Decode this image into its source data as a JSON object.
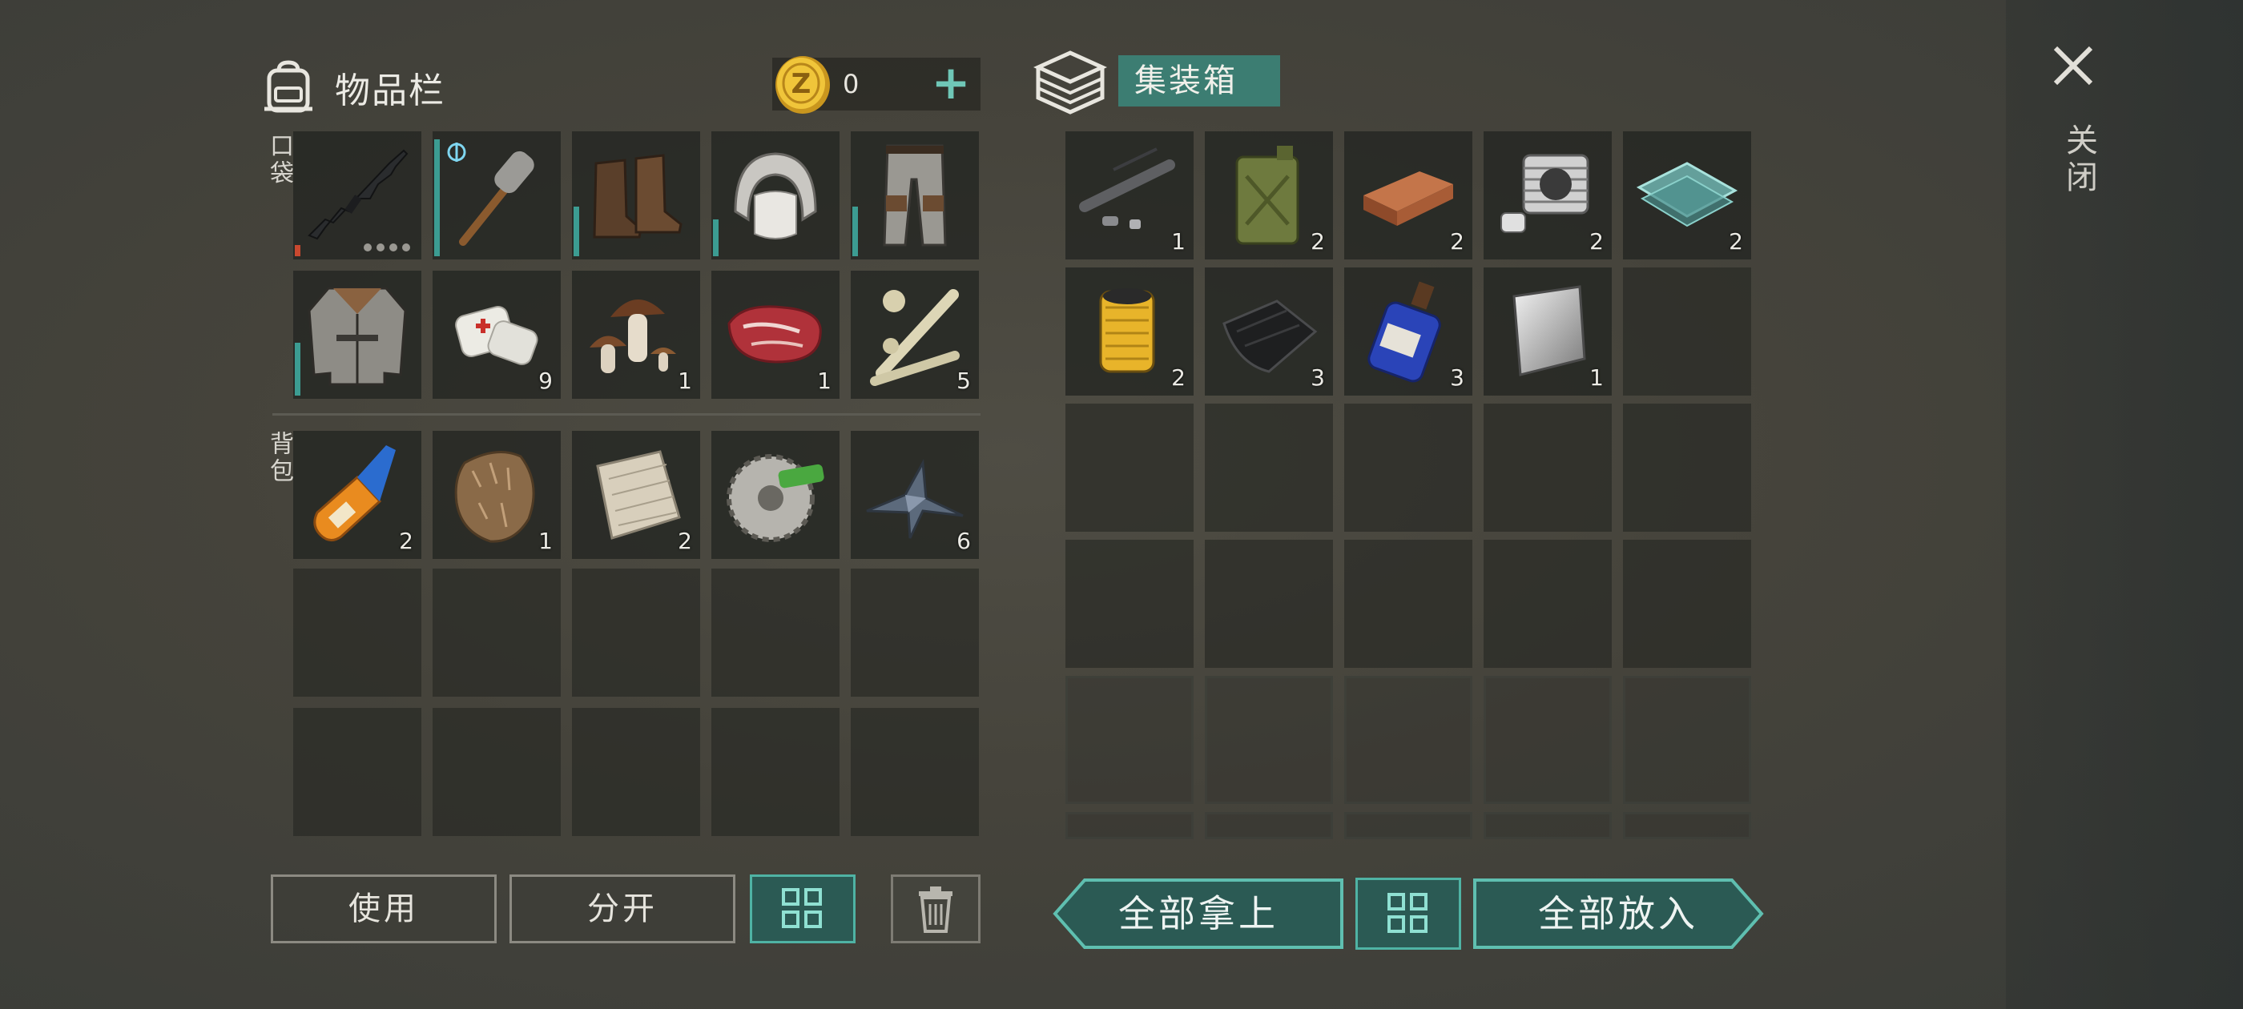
{
  "inventory": {
    "title": "物品栏",
    "coins": {
      "count": "0",
      "add_label": "+"
    },
    "section_pockets": "口袋",
    "section_backpack": "背包",
    "pockets": [
      {
        "name": "assault-rifle",
        "qty": "",
        "dots": 4,
        "durability": "low"
      },
      {
        "name": "spiked-club",
        "qty": "",
        "durability": 0.95
      },
      {
        "name": "leather-boots",
        "qty": "",
        "durability": 0.4
      },
      {
        "name": "fur-hat",
        "qty": "",
        "durability": 0.3
      },
      {
        "name": "leather-pants",
        "qty": "",
        "durability": 0.4
      },
      {
        "name": "leather-jacket",
        "qty": "",
        "durability": 0.45
      },
      {
        "name": "bandage",
        "qty": "9"
      },
      {
        "name": "mushrooms",
        "qty": "1"
      },
      {
        "name": "raw-meat",
        "qty": "1"
      },
      {
        "name": "bones",
        "qty": "5"
      }
    ],
    "backpack": [
      {
        "name": "glue",
        "qty": "2"
      },
      {
        "name": "fur",
        "qty": "1"
      },
      {
        "name": "cloth",
        "qty": "2"
      },
      {
        "name": "saw-blade",
        "qty": ""
      },
      {
        "name": "scrap-metal",
        "qty": "6"
      }
    ],
    "buttons": {
      "use": "使用",
      "split": "分开"
    }
  },
  "container": {
    "title": "集装箱",
    "items": [
      {
        "name": "rifle-parts",
        "qty": "1"
      },
      {
        "name": "jerry-can",
        "qty": "2"
      },
      {
        "name": "copper-ingot",
        "qty": "2"
      },
      {
        "name": "engine-cylinder",
        "qty": "2"
      },
      {
        "name": "glass-sheets",
        "qty": "2"
      },
      {
        "name": "oil-filter",
        "qty": "2"
      },
      {
        "name": "black-cloth",
        "qty": "3"
      },
      {
        "name": "ink-bottle",
        "qty": "3"
      },
      {
        "name": "metal-plate",
        "qty": "1"
      }
    ],
    "buttons": {
      "take_all": "全部拿上",
      "put_all": "全部放入"
    }
  },
  "close_label": "关闭",
  "colors": {
    "accent": "#3c7d72",
    "accent_light": "#6fc7b7",
    "durability": "#3c9c92",
    "durability_low": "#c9482f"
  }
}
